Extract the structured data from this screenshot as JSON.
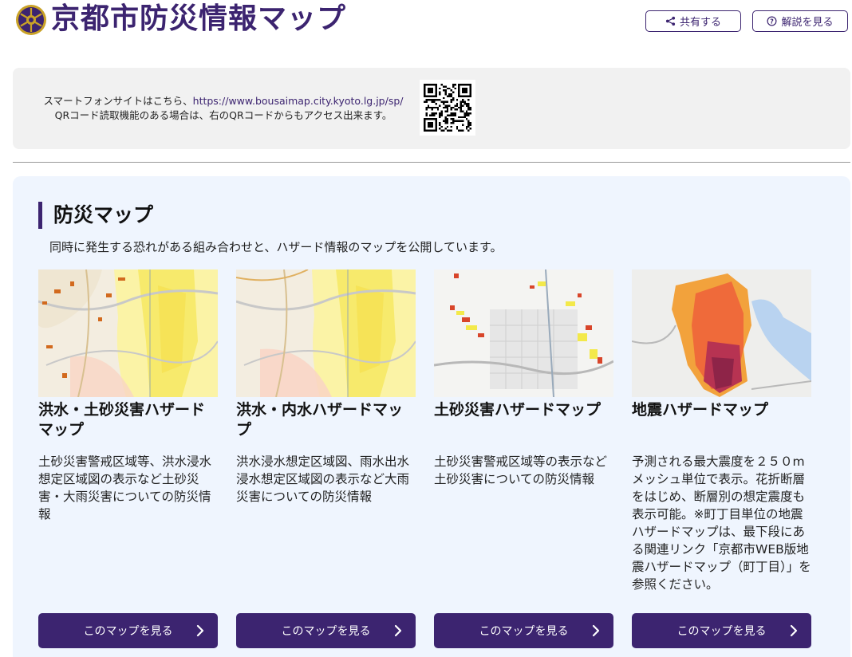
{
  "header": {
    "title": "京都市防災情報マップ",
    "share_label": "共有する",
    "help_label": "解説を見る"
  },
  "smartphone": {
    "line1_prefix": "スマートフォンサイトはこちら、",
    "url": "https://www.bousaimap.city.kyoto.lg.jp/sp/",
    "line2": "QRコード読取機能のある場合は、右のQRコードからもアクセス出来ます。"
  },
  "section": {
    "title": "防災マップ",
    "description": "同時に発生する恐れがある組み合わせと、ハザード情報のマップを公開しています。"
  },
  "cards": [
    {
      "title": "洪水・土砂災害ハザードマップ",
      "description": "土砂災害警戒区域等、洪水浸水想定区域図の表示など土砂災害・大雨災害についての防災情報",
      "button_label": "このマップを見る"
    },
    {
      "title": "洪水・内水ハザードマップ",
      "description": "洪水浸水想定区域図、雨水出水浸水想定区域図の表示など大雨災害についての防災情報",
      "button_label": "このマップを見る"
    },
    {
      "title": "土砂災害ハザードマップ",
      "description": "土砂災害警戒区域等の表示など土砂災害についての防災情報",
      "button_label": "このマップを見る"
    },
    {
      "title": "地震ハザードマップ",
      "description": "予測される最大震度を２５０mメッシュ単位で表示。花折断層をはじめ、断層別の想定震度も表示可能。※町丁目単位の地震ハザードマップは、最下段にある関連リンク「京都市WEB版地震ハザードマップ（町丁目）」を参照ください。",
      "button_label": "このマップを見る"
    }
  ],
  "colors": {
    "brand": "#3c2470",
    "section_bg": "#eff5fe",
    "notice_bg": "#f1f1f1"
  },
  "icons": {
    "logo": "kyoto-city-emblem-icon",
    "share": "share-icon",
    "help": "question-circle-icon",
    "button": "chevron-right-icon"
  }
}
